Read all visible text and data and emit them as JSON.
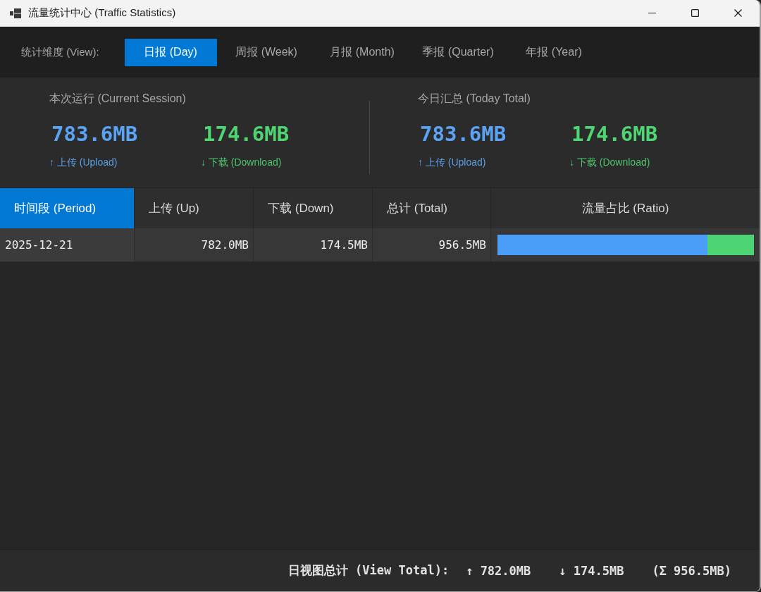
{
  "window": {
    "title": "流量统计中心 (Traffic Statistics)"
  },
  "view_bar": {
    "label": "统计维度 (View):",
    "tabs": [
      {
        "label": "日报 (Day)",
        "selected": true
      },
      {
        "label": "周报 (Week)",
        "selected": false
      },
      {
        "label": "月报 (Month)",
        "selected": false
      },
      {
        "label": "季报 (Quarter)",
        "selected": false
      },
      {
        "label": "年报 (Year)",
        "selected": false
      }
    ]
  },
  "summary": {
    "sections": [
      {
        "title": "本次运行 (Current Session)",
        "metrics": [
          {
            "kind": "upload",
            "value": "783.6MB",
            "label": "↑ 上传 (Upload)"
          },
          {
            "kind": "download",
            "value": "174.6MB",
            "label": "↓ 下载 (Download)"
          }
        ]
      },
      {
        "title": "今日汇总 (Today Total)",
        "metrics": [
          {
            "kind": "upload",
            "value": "783.6MB",
            "label": "↑ 上传 (Upload)"
          },
          {
            "kind": "download",
            "value": "174.6MB",
            "label": "↓ 下载 (Download)"
          }
        ]
      }
    ]
  },
  "table": {
    "columns": [
      {
        "label": "时间段 (Period)",
        "selected": true
      },
      {
        "label": "上传 (Up)",
        "selected": false
      },
      {
        "label": "下载 (Down)",
        "selected": false
      },
      {
        "label": "总计 (Total)",
        "selected": false
      },
      {
        "label": "流量占比 (Ratio)",
        "selected": false
      }
    ],
    "rows": [
      {
        "period": "2025-12-21",
        "up": "782.0MB",
        "down": "174.5MB",
        "total": "956.5MB",
        "ratio": {
          "level": 0.818
        }
      }
    ]
  },
  "footer": {
    "label": "日视图总计 (View Total):",
    "up": "↑ 782.0MB",
    "down": "↓ 174.5MB",
    "total": "(Σ 956.5MB)"
  }
}
